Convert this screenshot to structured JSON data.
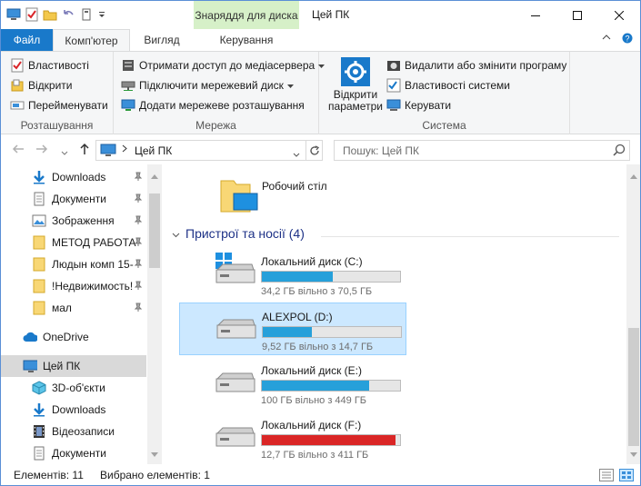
{
  "titlebar": {
    "context_tab": "Знаряддя для диска",
    "title": "Цей ПК"
  },
  "ribbon_tabs": {
    "file": "Файл",
    "computer": "Комп'ютер",
    "view": "Вигляд",
    "manage": "Керування"
  },
  "ribbon": {
    "location": {
      "name": "Розташування",
      "properties": "Властивості",
      "open": "Відкрити",
      "rename": "Перейменувати"
    },
    "network": {
      "name": "Мережа",
      "media_server": "Отримати доступ до медіасервера",
      "map_drive": "Підключити мережевий диск",
      "add_location": "Додати мережеве розташування"
    },
    "system": {
      "name": "Система",
      "open_settings_1": "Відкрити",
      "open_settings_2": "параметри",
      "uninstall": "Видалити або змінити програму",
      "sys_props": "Властивості системи",
      "manage": "Керувати"
    }
  },
  "address": {
    "path": "Цей ПК",
    "search_placeholder": "Пошук: Цей ПК"
  },
  "nav": {
    "items": [
      {
        "label": "Downloads",
        "pinned": true
      },
      {
        "label": "Документи",
        "pinned": true
      },
      {
        "label": "Зображення",
        "pinned": true
      },
      {
        "label": "МЕТОД РАБОТА",
        "pinned": true
      },
      {
        "label": "Людын комп 15-",
        "pinned": true
      },
      {
        "label": "!Недвижимость!",
        "pinned": true
      },
      {
        "label": "мал",
        "pinned": true
      },
      {
        "label": "OneDrive"
      },
      {
        "label": "Цей ПК"
      },
      {
        "label": "3D-об'єкти"
      },
      {
        "label": "Downloads"
      },
      {
        "label": "Відеозаписи"
      },
      {
        "label": "Документи"
      }
    ]
  },
  "content": {
    "desktop_label": "Робочий стіл",
    "group_title": "Пристрої та носії (4)",
    "drives": [
      {
        "name": "Локальний диск (C:)",
        "free": "34,2 ГБ вільно з 70,5 ГБ",
        "used_fraction": 0.515,
        "color": "#26a0da"
      },
      {
        "name": "ALEXPOL (D:)",
        "free": "9,52 ГБ вільно з 14,7 ГБ",
        "used_fraction": 0.352,
        "color": "#26a0da"
      },
      {
        "name": "Локальний диск (E:)",
        "free": "100 ГБ вільно з 449 ГБ",
        "used_fraction": 0.777,
        "color": "#26a0da"
      },
      {
        "name": "Локальний диск (F:)",
        "free": "12,7 ГБ вільно з 411 ГБ",
        "used_fraction": 0.969,
        "color": "#da2626"
      }
    ]
  },
  "status": {
    "items": "Елементів: 11",
    "selected": "Вибрано елементів: 1"
  }
}
